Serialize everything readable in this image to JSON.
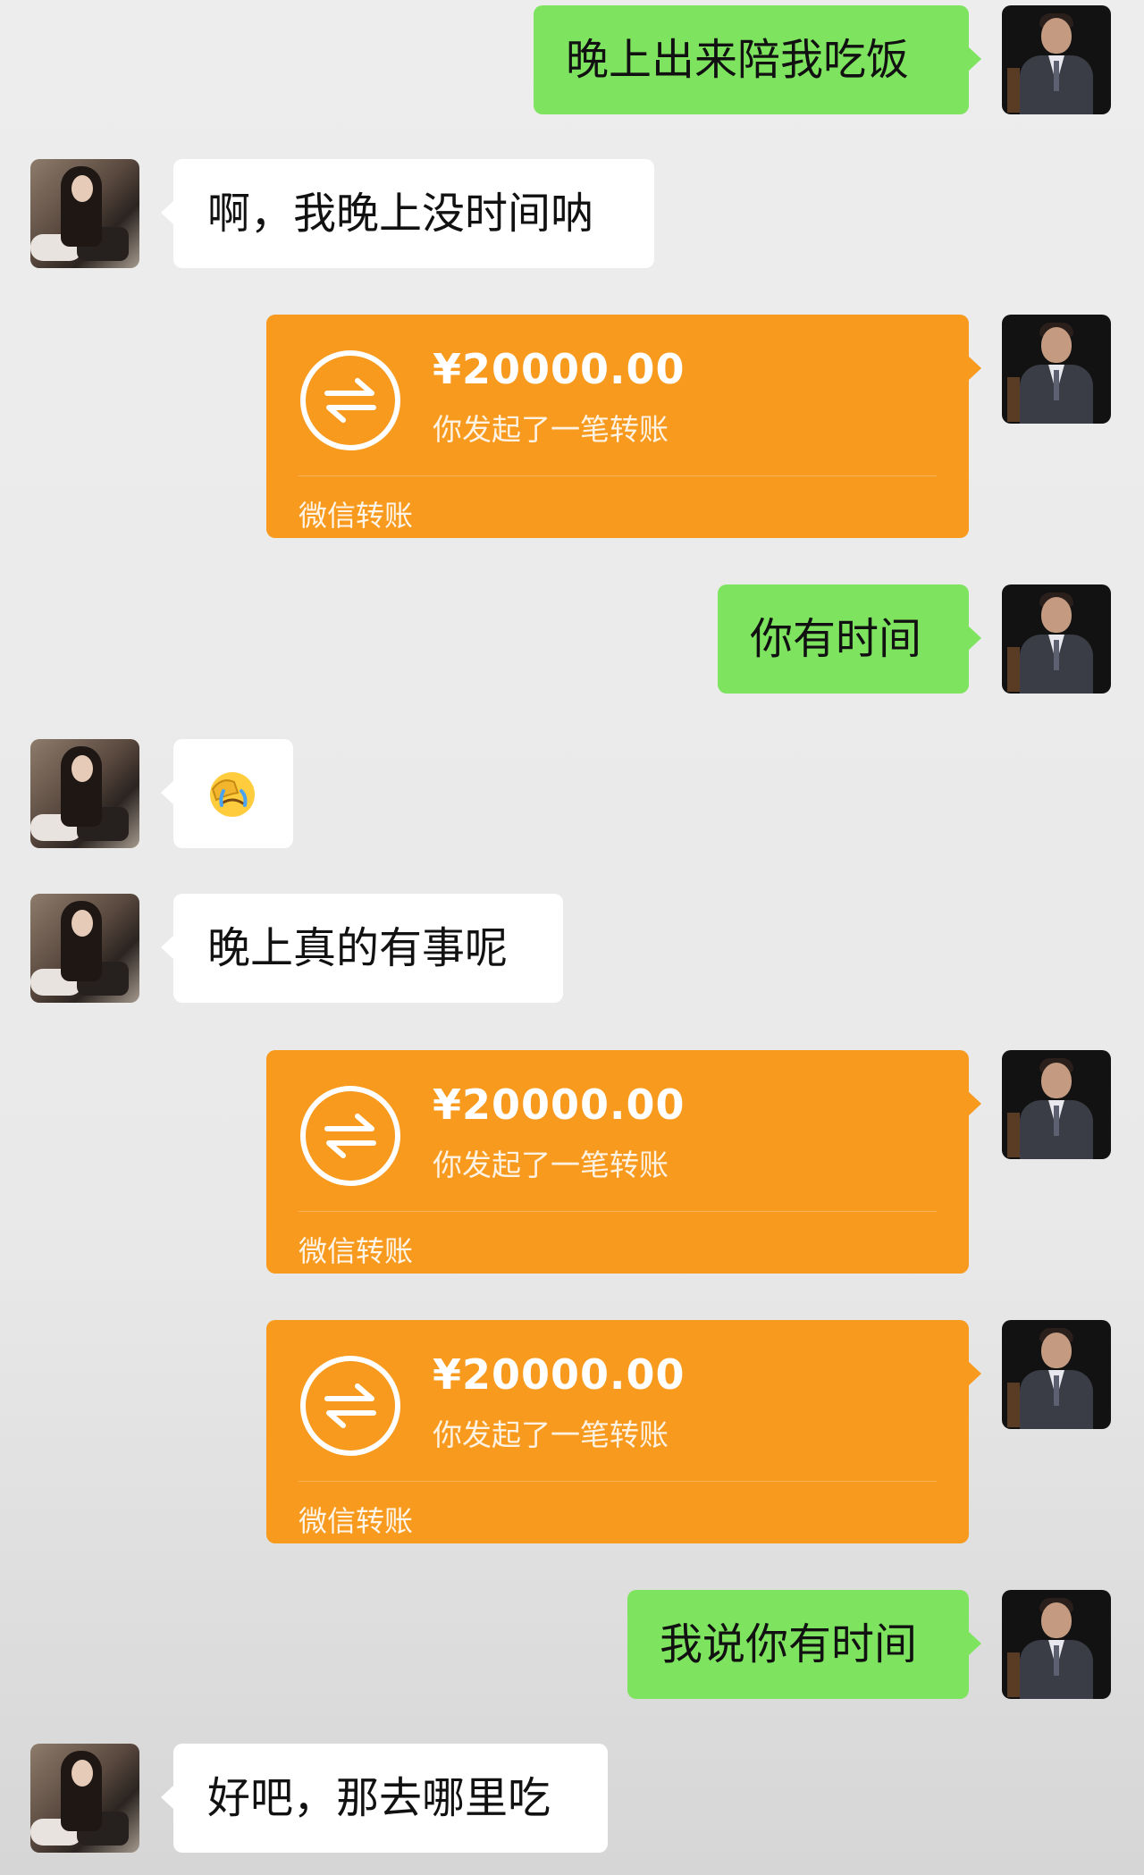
{
  "messages": [
    {
      "side": "right",
      "kind": "text",
      "text": "晚上出来陪我吃饭"
    },
    {
      "side": "left",
      "kind": "text",
      "text": "啊，我晚上没时间呐"
    },
    {
      "side": "right",
      "kind": "transfer",
      "amount": "¥20000.00",
      "desc": "你发起了一笔转账",
      "brand": "微信转账"
    },
    {
      "side": "right",
      "kind": "text",
      "text": "你有时间"
    },
    {
      "side": "left",
      "kind": "emoji",
      "emoji_name": "face-palm-crying-icon"
    },
    {
      "side": "left",
      "kind": "text",
      "text": "晚上真的有事呢"
    },
    {
      "side": "right",
      "kind": "transfer",
      "amount": "¥20000.00",
      "desc": "你发起了一笔转账",
      "brand": "微信转账"
    },
    {
      "side": "right",
      "kind": "transfer",
      "amount": "¥20000.00",
      "desc": "你发起了一笔转账",
      "brand": "微信转账"
    },
    {
      "side": "right",
      "kind": "text",
      "text": "我说你有时间"
    },
    {
      "side": "left",
      "kind": "text",
      "text": "好吧，那去哪里吃"
    }
  ],
  "colors": {
    "sent_bubble": "#7ee45f",
    "received_bubble": "#ffffff",
    "transfer_card": "#f79a1e",
    "background": "#ededed"
  }
}
